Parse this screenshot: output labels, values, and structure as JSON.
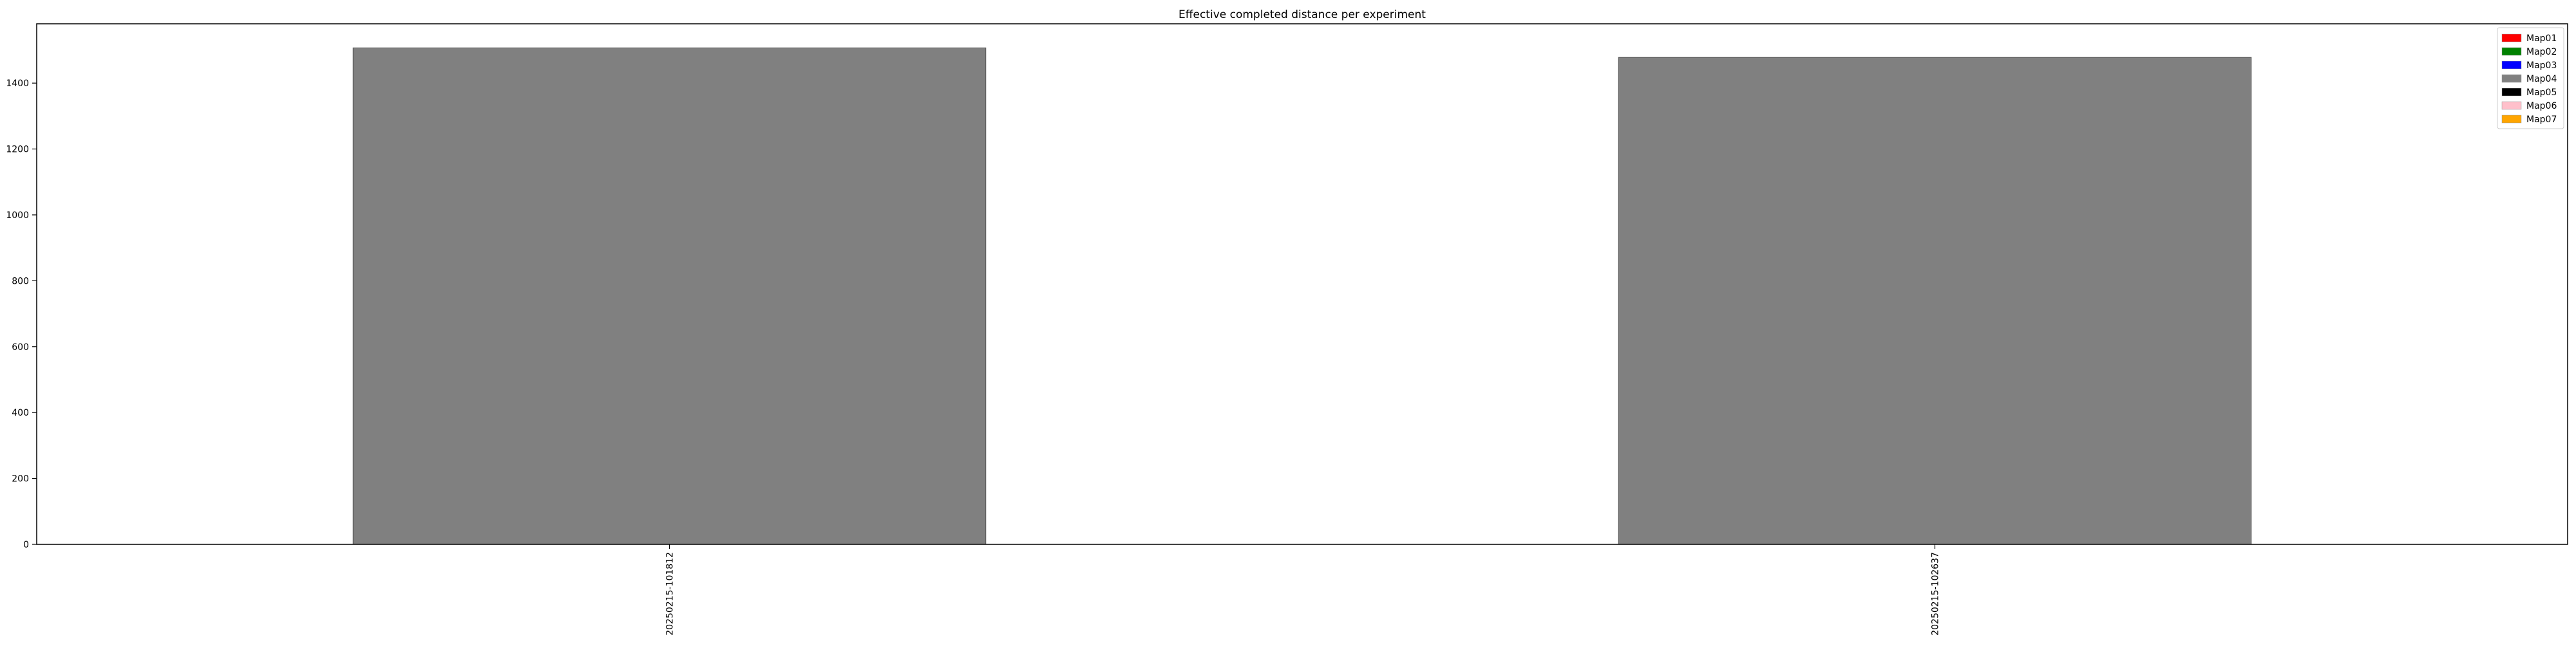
{
  "chart_data": {
    "type": "bar",
    "title": "Effective completed distance per experiment",
    "xlabel": "",
    "ylabel": "",
    "categories": [
      "20250215-101812",
      "20250215-102637"
    ],
    "series": [
      {
        "name": "Map04",
        "values": [
          1507,
          1478
        ],
        "color": "#808080"
      }
    ],
    "ylim": [
      0,
      1580
    ],
    "yticks": [
      0,
      200,
      400,
      600,
      800,
      1000,
      1200,
      1400
    ],
    "grid": false,
    "legend_position": "top-right",
    "legend": [
      {
        "label": "Map01",
        "color": "#ff0000"
      },
      {
        "label": "Map02",
        "color": "#008000"
      },
      {
        "label": "Map03",
        "color": "#0000ff"
      },
      {
        "label": "Map04",
        "color": "#808080"
      },
      {
        "label": "Map05",
        "color": "#000000"
      },
      {
        "label": "Map06",
        "color": "#ffc0cb"
      },
      {
        "label": "Map07",
        "color": "#ffa500"
      }
    ]
  }
}
